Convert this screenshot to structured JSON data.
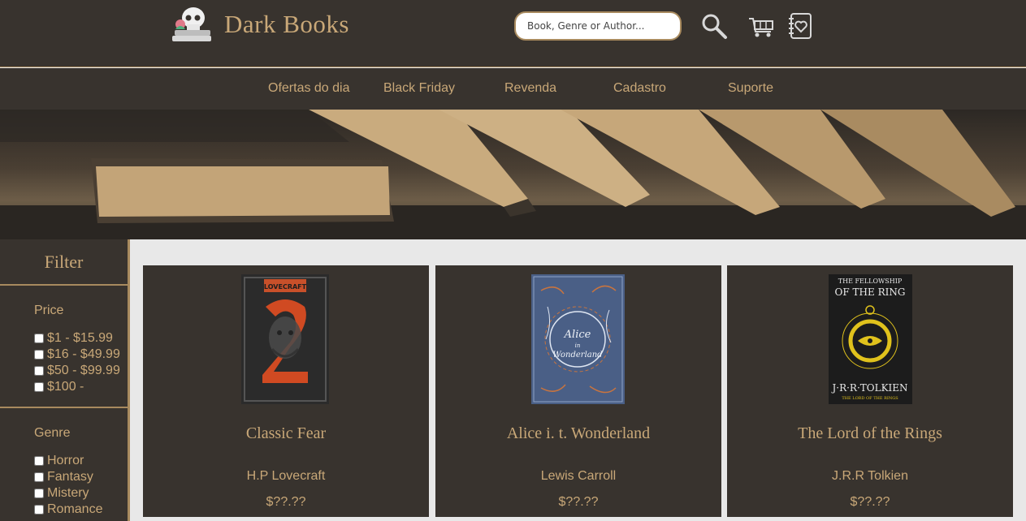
{
  "header": {
    "brand": "Dark Books",
    "search_placeholder": "Book, Genre or Author...",
    "icons": [
      "skull-books-logo-icon",
      "magnifier-icon",
      "cart-icon",
      "notebook-heart-icon"
    ]
  },
  "nav": {
    "items": [
      {
        "label": "Ofertas do dia"
      },
      {
        "label": "Black Friday"
      },
      {
        "label": "Revenda"
      },
      {
        "label": "Cadastro"
      },
      {
        "label": "Suporte"
      }
    ]
  },
  "sidebar": {
    "title": "Filter",
    "price": {
      "label": "Price",
      "options": [
        "$1 - $15.99",
        "$16 - $49.99",
        "$50 - $99.99",
        "$100 -"
      ]
    },
    "genre": {
      "label": "Genre",
      "options": [
        "Horror",
        "Fantasy",
        "Mistery",
        "Romance"
      ]
    }
  },
  "products": [
    {
      "title": "Classic Fear",
      "author": "H.P Lovecraft",
      "price": "$??.??",
      "cover_text": "LOVECRAFT"
    },
    {
      "title": "Alice i. t. Wonderland",
      "author": "Lewis Carroll",
      "price": "$??.??",
      "cover_text": "Alice in Wonderland"
    },
    {
      "title": "The Lord of the Rings",
      "author": "J.R.R Tolkien",
      "price": "$??.??",
      "cover_text": "THE FELLOWSHIP OF THE RING",
      "cover_author": "J·R·R·TOLKIEN"
    }
  ],
  "colors": {
    "dark": "#38332e",
    "gold": "#c9a878",
    "accent_line": "#a88a5e",
    "content_bg": "#e8e8e8"
  }
}
